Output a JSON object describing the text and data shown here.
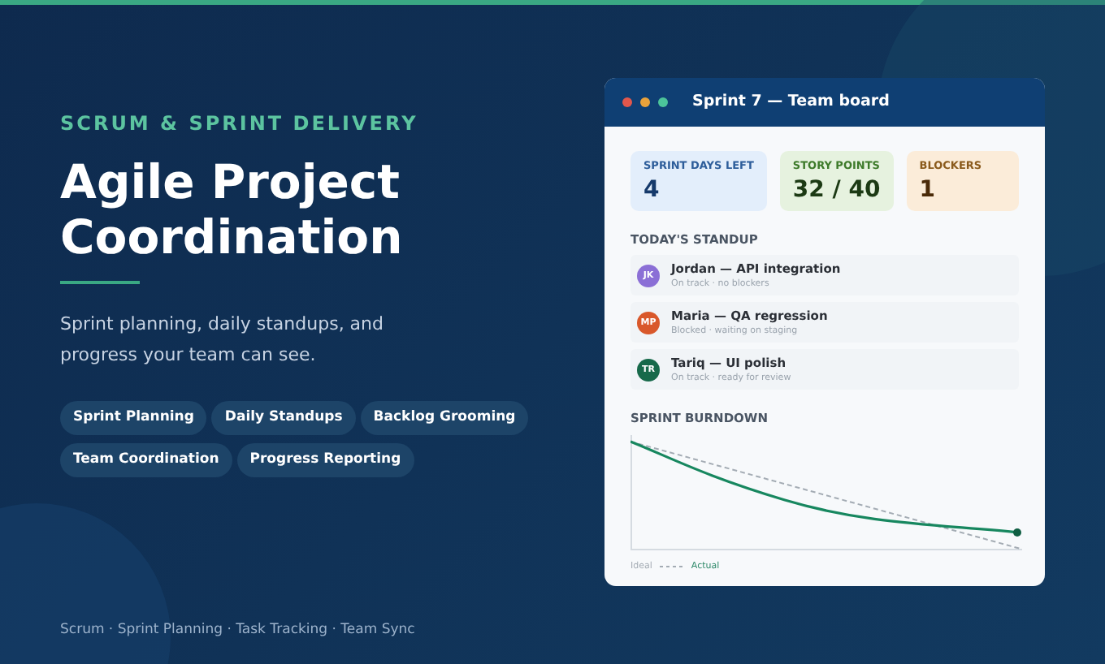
{
  "hero": {
    "eyebrow": "SCRUM & SPRINT DELIVERY",
    "title": "Agile Project Coordination",
    "subtitle": "Sprint planning, daily standups, and progress your team can see.",
    "tags": [
      "Sprint Planning",
      "Daily Standups",
      "Backlog Grooming",
      "Team Coordination",
      "Progress Reporting"
    ],
    "footer": "Scrum · Sprint Planning · Task Tracking · Team Sync"
  },
  "board": {
    "title": "Sprint 7 — Team board",
    "stats": [
      {
        "kind": "info",
        "label": "SPRINT DAYS LEFT",
        "value": "4"
      },
      {
        "kind": "success",
        "label": "STORY POINTS",
        "value": "32 / 40"
      },
      {
        "kind": "warning",
        "label": "BLOCKERS",
        "value": "1"
      }
    ],
    "standup_title": "TODAY'S STANDUP",
    "standup": [
      {
        "initials": "JK",
        "color": "#8b6fd6",
        "title": "Jordan — API integration",
        "status": "On track · no blockers"
      },
      {
        "initials": "MP",
        "color": "#d9582b",
        "title": "Maria — QA regression",
        "status": "Blocked · waiting on staging"
      },
      {
        "initials": "TR",
        "color": "#17694a",
        "title": "Tariq — UI polish",
        "status": "On track · ready for review"
      }
    ],
    "burndown_title": "SPRINT BURNDOWN",
    "legend": [
      {
        "kind": "ideal",
        "label": "Ideal"
      },
      {
        "kind": "actual",
        "label": "Actual"
      }
    ]
  }
}
